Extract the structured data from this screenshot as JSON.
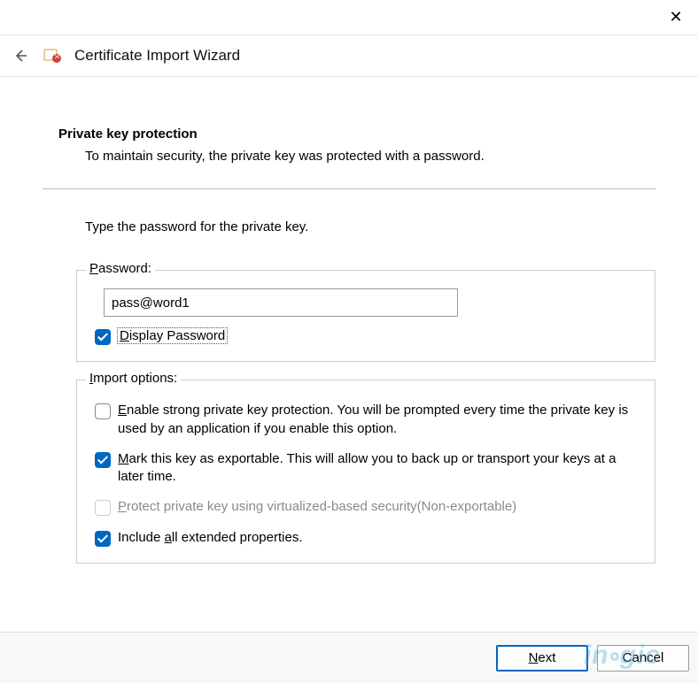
{
  "window": {
    "close_glyph": "✕"
  },
  "header": {
    "back_glyph": "←",
    "title": "Certificate Import Wizard"
  },
  "content": {
    "heading": "Private key protection",
    "subheading": "To maintain security, the private key was protected with a password.",
    "instruction": "Type the password for the private key."
  },
  "password_group": {
    "legend_prefix_ul": "P",
    "legend_rest": "assword:",
    "value": "pass@word1",
    "display_checked": true,
    "display_label_ul": "D",
    "display_label_rest": "isplay Password"
  },
  "import_group": {
    "legend_prefix_ul": "I",
    "legend_rest": "mport options:",
    "options": [
      {
        "checked": false,
        "disabled": false,
        "ul": "E",
        "text_rest": "nable strong private key protection. You will be prompted every time the private key is used by an application if you enable this option."
      },
      {
        "checked": true,
        "disabled": false,
        "ul": "M",
        "text_rest": "ark this key as exportable. This will allow you to back up or transport your keys at a later time."
      },
      {
        "checked": false,
        "disabled": true,
        "ul": "P",
        "text_rest": "rotect private key using virtualized-based security(Non-exportable)"
      },
      {
        "checked": true,
        "disabled": false,
        "ul": "a",
        "prefix": "Include ",
        "text_rest": "ll extended properties."
      }
    ]
  },
  "buttons": {
    "next_ul": "N",
    "next_rest": "ext",
    "cancel": "Cancel"
  },
  "watermark": {
    "pre": "in",
    "post": "gic"
  }
}
